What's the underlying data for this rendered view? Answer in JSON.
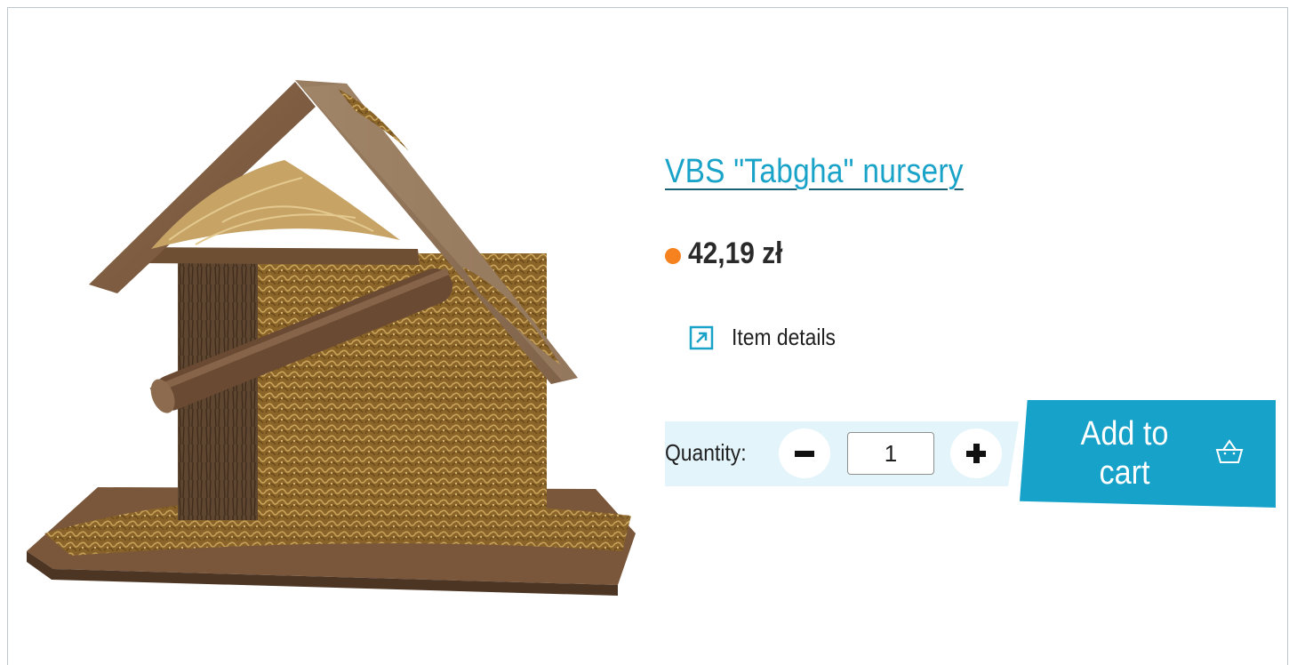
{
  "product": {
    "title": "VBS \"Tabgha\" nursery",
    "price": "42,19 zł",
    "availability_color": "#f5821f",
    "image_icon": "wooden-nativity-stable-image"
  },
  "details": {
    "label": "Item details",
    "icon": "external-link-arrow-icon"
  },
  "quantity": {
    "label": "Quantity:",
    "value": "1",
    "decrement_icon": "minus-icon",
    "increment_icon": "plus-icon"
  },
  "cart": {
    "label": "Add to cart",
    "icon": "basket-icon"
  },
  "colors": {
    "accent": "#17a2c9",
    "band": "#e3f4fa"
  }
}
